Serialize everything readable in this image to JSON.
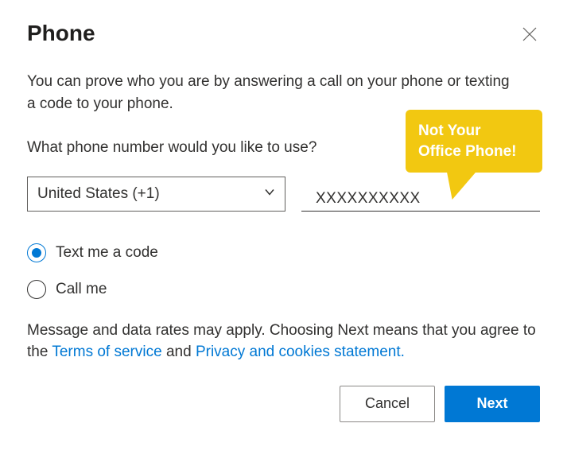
{
  "title": "Phone",
  "intro": "You can prove who you are by answering a call on your phone or texting a code to your phone.",
  "prompt": "What phone number would you like to use?",
  "country": {
    "selected": "United States (+1)"
  },
  "phone": {
    "value": "XXXXXXXXXX"
  },
  "options": {
    "text": "Text me a code",
    "call": "Call me",
    "selected": "text"
  },
  "disclaimer": {
    "prefix": "Message and data rates may apply. Choosing Next means that you agree to the ",
    "tos": "Terms of service",
    "and": " and ",
    "privacy": "Privacy and cookies statement.",
    "suffix": ""
  },
  "buttons": {
    "cancel": "Cancel",
    "next": "Next"
  },
  "callout": {
    "line1": "Not Your",
    "line2": "Office Phone!"
  },
  "colors": {
    "accent": "#0078d4",
    "callout": "#f2c811"
  }
}
